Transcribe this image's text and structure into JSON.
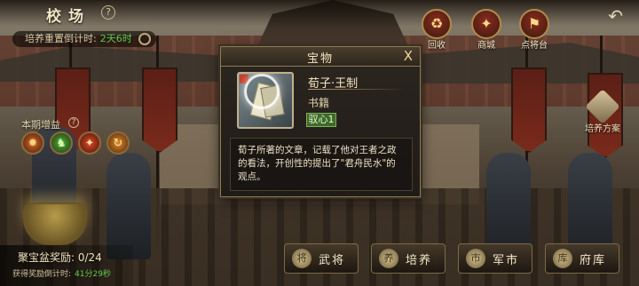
{
  "header": {
    "title": "校场",
    "help": "?"
  },
  "timer": {
    "label": "培养重置倒计时:",
    "value": "2天6时"
  },
  "top_buttons": [
    {
      "label": "回收",
      "icon": "recycle-icon",
      "glyph": "♻"
    },
    {
      "label": "商城",
      "icon": "shop-icon",
      "glyph": "✦"
    },
    {
      "label": "点将台",
      "icon": "general-stage-icon",
      "glyph": "⚑"
    }
  ],
  "back": {
    "glyph": "↶"
  },
  "bonus": {
    "label": "本期增益",
    "help": "?",
    "icons": [
      {
        "name": "fire-bonus-icon",
        "glyph": "✹"
      },
      {
        "name": "soldier-bonus-icon",
        "glyph": "♞"
      },
      {
        "name": "blade-bonus-icon",
        "glyph": "✦"
      },
      {
        "name": "swirl-bonus-icon",
        "glyph": "↻"
      }
    ]
  },
  "treasure": {
    "reward_label": "聚宝盆奖励: 0/24",
    "countdown_label": "获得奖励倒计时:",
    "countdown_value": "41分29秒"
  },
  "plan_button": {
    "label": "培养方案"
  },
  "bottom_nav": [
    {
      "label": "武将",
      "glyph": "将"
    },
    {
      "label": "培养",
      "glyph": "养"
    },
    {
      "label": "军市",
      "glyph": "市"
    },
    {
      "label": "府库",
      "glyph": "库"
    }
  ],
  "modal": {
    "title": "宝物",
    "close": "X",
    "item_name": "荀子·王制",
    "item_type": "书籍",
    "item_tag": "驭心1",
    "description": "荀子所著的文章，记载了他对王者之政的看法，开创性的提出了\"君舟民水\"的观点。"
  },
  "colors": {
    "green_text": "#62c94d",
    "panel_border": "#8e7a52",
    "tag_bg": "#3d6a2a"
  }
}
